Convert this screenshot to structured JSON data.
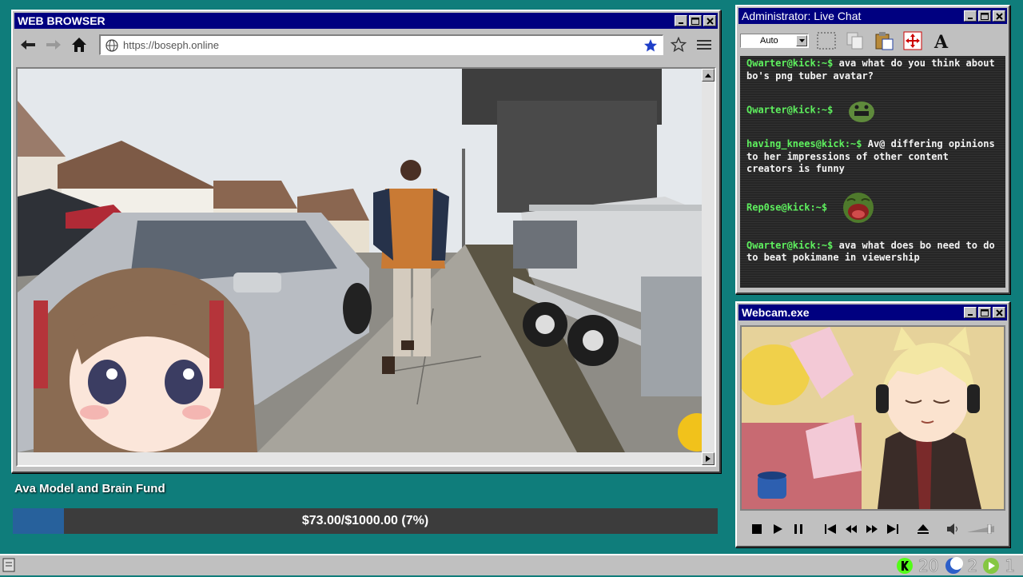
{
  "browser": {
    "title": "WEB BROWSER",
    "url": "https://boseph.online"
  },
  "chat": {
    "title": "Administrator: Live Chat",
    "zoom_select": "Auto",
    "messages": [
      {
        "user": "Qwarter@kick:~$",
        "text": "ava what do you think about bo's png tuber avatar?"
      },
      {
        "user": "Qwarter@kick:~$",
        "text": "",
        "emote": "green-blob-emote"
      },
      {
        "user": "having_knees@kick:~$",
        "text": "Av@ differing opinions to her impressions of other content creators is funny"
      },
      {
        "user": "Rep0se@kick:~$",
        "text": "",
        "emote": "laughing-pepe-emote"
      },
      {
        "user": "Qwarter@kick:~$",
        "text": "ava what does bo need to do to beat pokimane in viewership"
      }
    ]
  },
  "webcam": {
    "title": "Webcam.exe"
  },
  "fund": {
    "label": "Ava Model and Brain Fund",
    "amount_text": "$73.00/$1000.00 (7%)",
    "progress": 0.073
  },
  "tray": {
    "count_a": "20",
    "count_b": "2",
    "count_c": "1"
  },
  "colors": {
    "desktop": "#0f7d7b",
    "titlebar": "#000080",
    "chat_user": "#5ef05e",
    "fund_fill": "#27619c"
  }
}
